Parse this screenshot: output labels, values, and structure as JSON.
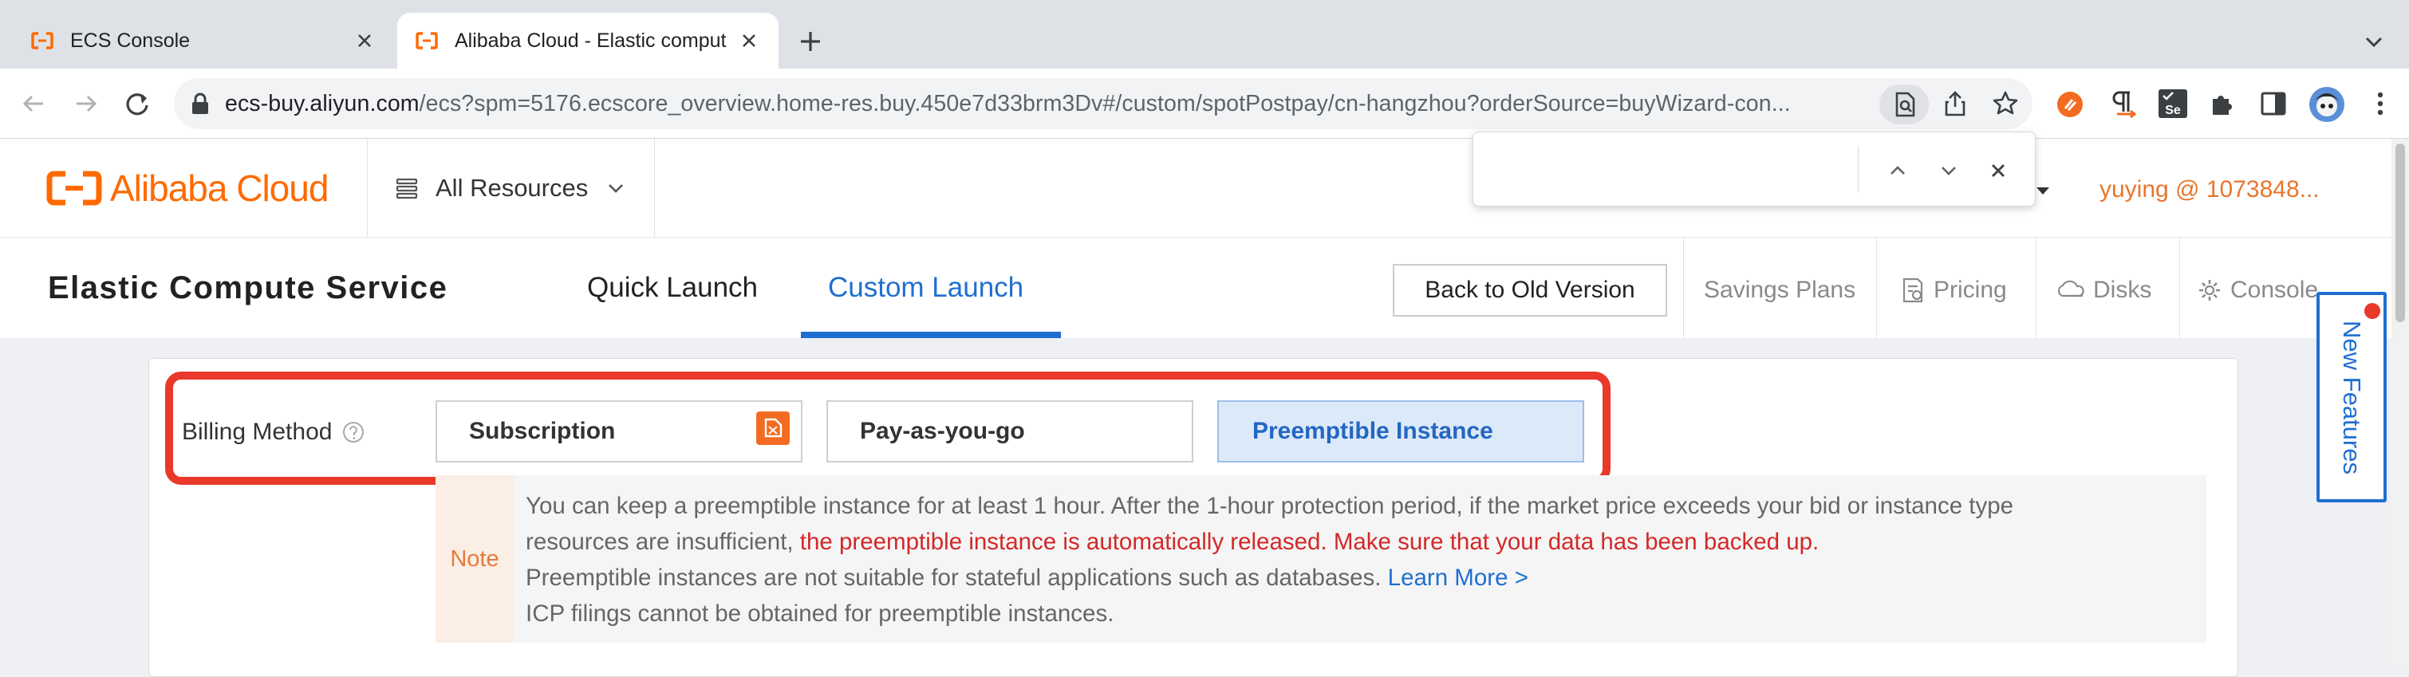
{
  "browser": {
    "tabs": [
      {
        "title": "ECS Console",
        "active": false
      },
      {
        "title": "Alibaba Cloud - Elastic comput",
        "active": true
      }
    ],
    "url": {
      "host": "ecs-buy.aliyun.com",
      "path": "/ecs?spm=5176.ecscore_overview.home-res.buy.450e7d33brm3Dv#/custom/spotPostpay/cn-hangzhou?orderSource=buyWizard-con..."
    }
  },
  "header": {
    "logo_text": "Alibaba Cloud",
    "resources_label": "All Resources",
    "user_label": "yuying @ 1073848...",
    "find_query": ""
  },
  "subheader": {
    "title": "Elastic Compute Service",
    "tabs": [
      {
        "label": "Quick Launch",
        "active": false
      },
      {
        "label": "Custom Launch",
        "active": true
      }
    ],
    "back_button": "Back to Old Version",
    "links": [
      "Savings Plans",
      "Pricing",
      "Disks",
      "Console"
    ]
  },
  "billing": {
    "label": "Billing Method",
    "options": [
      {
        "label": "Subscription",
        "selected": false
      },
      {
        "label": "Pay-as-you-go",
        "selected": false
      },
      {
        "label": "Preemptible Instance",
        "selected": true
      }
    ]
  },
  "note": {
    "tag": "Note",
    "line1": "You can keep a preemptible instance for at least 1 hour. After the 1-hour protection period, if the market price exceeds your bid or instance type",
    "line2_plain": "resources are insufficient, ",
    "line2_red": "the preemptible instance is automatically released. Make sure that your data has been backed up.",
    "line3_plain": "Preemptible instances are not suitable for stateful applications such as databases. ",
    "line3_link": "Learn More >",
    "line4": "ICP filings cannot be obtained for preemptible instances."
  },
  "side_tab": {
    "label": "New Features"
  },
  "colors": {
    "brand_orange": "#ff6a00",
    "accent_blue": "#1f6fd1",
    "highlight_red": "#e8392a"
  }
}
